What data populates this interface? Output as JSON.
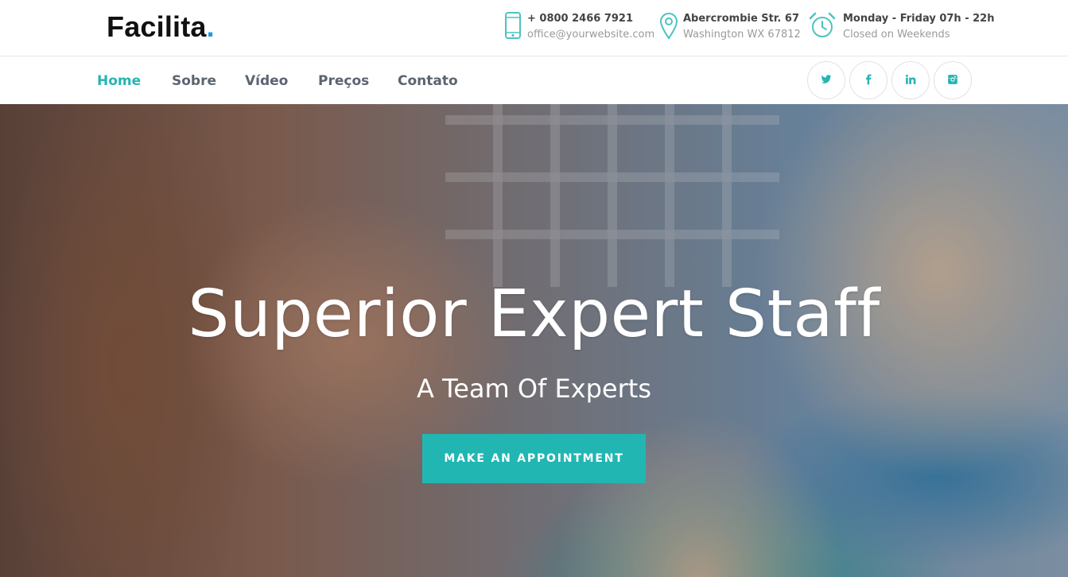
{
  "brand": {
    "name": "Facilita",
    "dot": ".",
    "accent_color": "#1a9be0"
  },
  "contact": {
    "phone": {
      "icon": "smartphone-icon",
      "line1": "+ 0800 2466 7921",
      "line2": "office@yourwebsite.com"
    },
    "address": {
      "icon": "map-pin-icon",
      "line1": "Abercrombie Str. 67",
      "line2": "Washington WX 67812"
    },
    "hours": {
      "icon": "alarm-clock-icon",
      "line1": "Monday - Friday 07h - 22h",
      "line2": "Closed on Weekends"
    }
  },
  "nav": {
    "active_color": "#27b4b3",
    "items": [
      {
        "label": "Home",
        "active": true
      },
      {
        "label": "Sobre",
        "active": false
      },
      {
        "label": "Vídeo",
        "active": false
      },
      {
        "label": "Preços",
        "active": false
      },
      {
        "label": "Contato",
        "active": false
      }
    ]
  },
  "social": [
    {
      "name": "twitter",
      "icon": "twitter-icon"
    },
    {
      "name": "facebook",
      "icon": "facebook-icon"
    },
    {
      "name": "linkedin",
      "icon": "linkedin-icon"
    },
    {
      "name": "instagram",
      "icon": "instagram-icon"
    }
  ],
  "hero": {
    "title": "Superior Expert Staff",
    "subtitle": "A Team Of Experts",
    "cta_label": "MAKE AN APPOINTMENT",
    "cta_color": "#22b6b3"
  }
}
